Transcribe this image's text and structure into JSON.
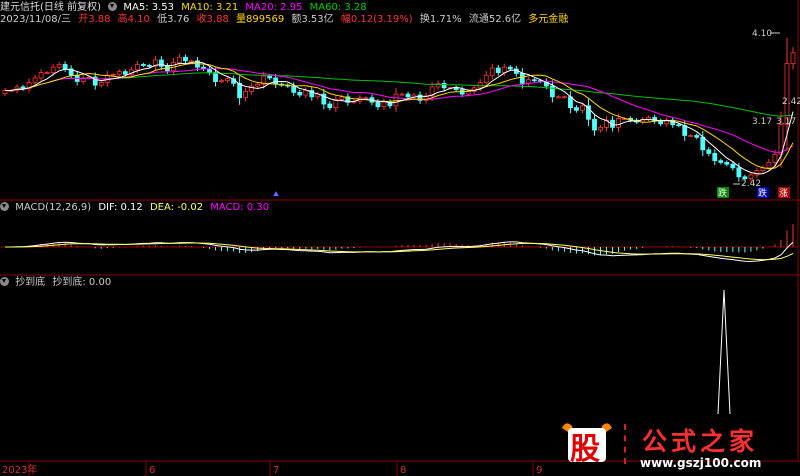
{
  "header": {
    "title": "建元信托(日线 前复权)",
    "ma5_label": "MA5: 3.53",
    "ma10_label": "MA10: 3.21",
    "ma20_label": "MA20: 2.95",
    "ma60_label": "MA60: 3.28",
    "info": {
      "date": "2023/11/08/三",
      "open": "开3.88",
      "high": "高4.10",
      "low": "低3.76",
      "close": "收3.88",
      "volume": "量899569",
      "amount": "额3.53亿",
      "change": "幅0.12(3.19%)",
      "turnover": "换1.71%",
      "float": "流通52.6亿",
      "concept": "多元金融"
    }
  },
  "macd_header": {
    "name": "MACD(12,26,9)",
    "dif": "DIF: 0.12",
    "dea": "DEA: -0.02",
    "macd": "MACD: 0.30"
  },
  "indicator_header": {
    "name": "抄到底",
    "value_label": "抄到底: 0.00"
  },
  "price_annotations": {
    "high": "4.10",
    "low_right": "2.42",
    "low_marker": "2.42",
    "mid": "3.17",
    "ref": "3.17"
  },
  "signal_labels": [
    "跌",
    "跌",
    "涨"
  ],
  "watermark": {
    "logo": "股",
    "name": "公式之家",
    "url": "www.gszj100.com"
  },
  "colors": {
    "up": "#ff3232",
    "down": "#54ffff",
    "ma5": "#ffffff",
    "ma10": "#ffd700",
    "ma20": "#ff00ff",
    "ma60": "#00c000",
    "dea": "#ffff66",
    "grid": "#8b0000"
  },
  "chart_data": {
    "type": "candlestick",
    "x_ticks": [
      "2023年",
      "6",
      "7",
      "8",
      "9"
    ],
    "closes": [
      3.46,
      3.46,
      3.5,
      3.48,
      3.55,
      3.6,
      3.66,
      3.66,
      3.72,
      3.75,
      3.7,
      3.63,
      3.56,
      3.6,
      3.61,
      3.52,
      3.55,
      3.63,
      3.64,
      3.67,
      3.64,
      3.69,
      3.75,
      3.74,
      3.73,
      3.8,
      3.73,
      3.68,
      3.77,
      3.83,
      3.79,
      3.79,
      3.72,
      3.7,
      3.66,
      3.56,
      3.57,
      3.59,
      3.54,
      3.38,
      3.45,
      3.51,
      3.53,
      3.62,
      3.6,
      3.53,
      3.52,
      3.51,
      3.44,
      3.41,
      3.46,
      3.39,
      3.42,
      3.31,
      3.27,
      3.36,
      3.39,
      3.33,
      3.34,
      3.38,
      3.38,
      3.33,
      3.28,
      3.33,
      3.29,
      3.42,
      3.42,
      3.39,
      3.41,
      3.35,
      3.4,
      3.5,
      3.54,
      3.49,
      3.49,
      3.47,
      3.42,
      3.45,
      3.49,
      3.55,
      3.63,
      3.71,
      3.66,
      3.72,
      3.7,
      3.65,
      3.54,
      3.58,
      3.57,
      3.56,
      3.51,
      3.39,
      3.39,
      3.39,
      3.27,
      3.24,
      3.29,
      3.14,
      3.02,
      3.05,
      3.13,
      3.05,
      3.15,
      3.15,
      3.13,
      3.11,
      3.14,
      3.16,
      3.12,
      3.09,
      3.13,
      3.08,
      3.07,
      2.96,
      2.96,
      2.94,
      2.8,
      2.76,
      2.68,
      2.66,
      2.64,
      2.6,
      2.5,
      2.48,
      2.52,
      2.57,
      2.6,
      2.66,
      2.75,
      3.08,
      3.76,
      3.88
    ]
  }
}
